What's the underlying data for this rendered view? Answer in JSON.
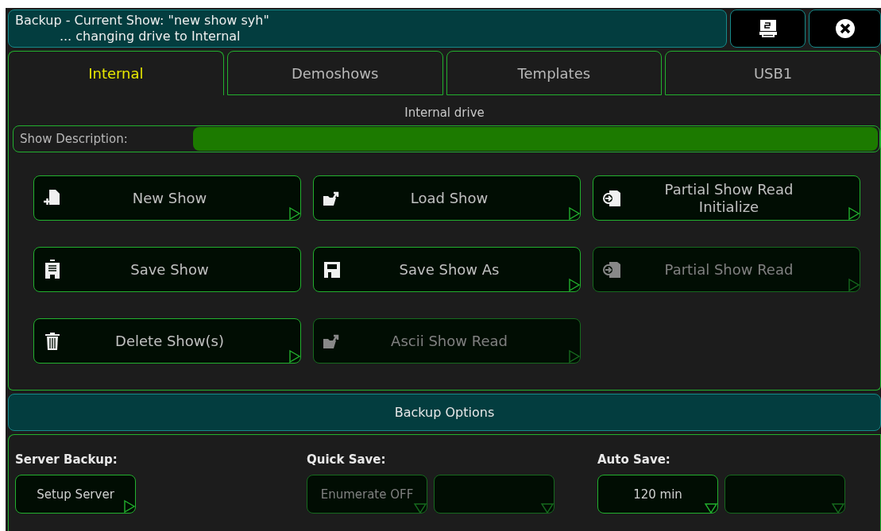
{
  "window": {
    "title": "Backup - Current Show: \"new show syh\"",
    "subtitle": "... changing drive to Internal"
  },
  "header_buttons": [
    {
      "kind": "display"
    },
    {
      "kind": "close"
    }
  ],
  "tabs": [
    {
      "label": "Internal",
      "selected": true
    },
    {
      "label": "Demoshows",
      "selected": false
    },
    {
      "label": "Templates",
      "selected": false
    },
    {
      "label": "USB1",
      "selected": false
    }
  ],
  "drive_label": "Internal drive",
  "show_description": {
    "label": "Show Description:"
  },
  "buttons": [
    {
      "label": "New Show",
      "kind": "new",
      "disabled": false,
      "submenu": true
    },
    {
      "label": "Load Show",
      "kind": "load",
      "disabled": false,
      "submenu": true
    },
    {
      "label": "Partial Show Read\nInitialize",
      "kind": "import",
      "disabled": false,
      "submenu": true
    },
    {
      "label": "Save Show",
      "kind": "save",
      "disabled": false,
      "submenu": false
    },
    {
      "label": "Save Show As",
      "kind": "saveas",
      "disabled": false,
      "submenu": true
    },
    {
      "label": "Partial Show Read",
      "kind": "import",
      "disabled": true,
      "submenu": true
    },
    {
      "label": "Delete Show(s)",
      "kind": "delete",
      "disabled": false,
      "submenu": true
    },
    {
      "label": "Ascii Show Read",
      "kind": "load",
      "disabled": true,
      "submenu": true
    }
  ],
  "backup_options": {
    "title": "Backup Options",
    "groups": [
      {
        "label": "Server Backup:",
        "controls": [
          {
            "text": "Setup Server",
            "disabled": false,
            "kind": "button"
          }
        ]
      },
      {
        "label": "Quick Save:",
        "controls": [
          {
            "text": "Enumerate OFF",
            "disabled": true,
            "kind": "dropdown"
          },
          {
            "disabled": true,
            "kind": "dropdown"
          }
        ]
      },
      {
        "label": "Auto Save:",
        "controls": [
          {
            "text": "120 min",
            "disabled": false,
            "kind": "dropdown"
          },
          {
            "disabled": true,
            "kind": "dropdown"
          }
        ]
      }
    ]
  }
}
